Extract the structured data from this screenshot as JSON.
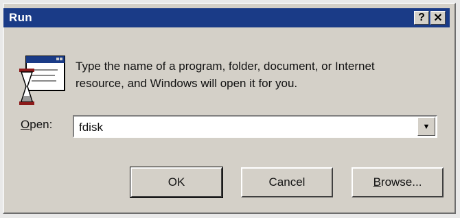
{
  "window": {
    "title": "Run",
    "help_button": "?",
    "close_button": "✕"
  },
  "dialog": {
    "message_line1": "Type the name of a program, folder, document, or Internet",
    "message_line2": "resource, and Windows will open it for you.",
    "open_label_mnemonic": "O",
    "open_label_rest": "pen:",
    "open_value": "fdisk",
    "dropdown_arrow": "▼"
  },
  "buttons": {
    "ok": "OK",
    "cancel": "Cancel",
    "browse_mnemonic": "B",
    "browse_rest": "rowse..."
  },
  "icons": [
    "run-icon",
    "hourglass-icon",
    "help-icon",
    "close-icon",
    "chevron-down-icon"
  ],
  "colors": {
    "titlebar": "#1a3b87",
    "face": "#d4d0c8"
  }
}
